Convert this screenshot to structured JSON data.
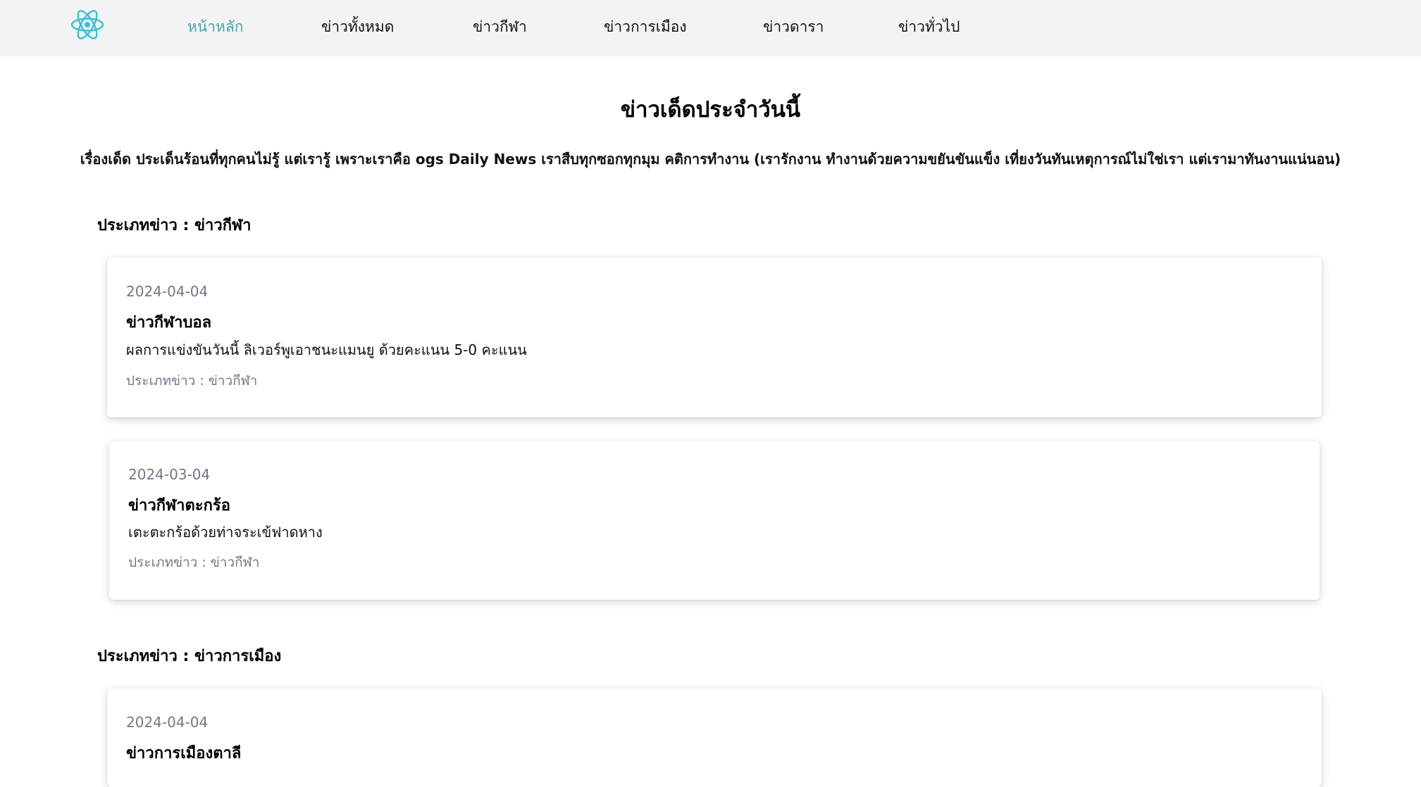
{
  "nav": {
    "items": [
      {
        "label": "หน้าหลัก",
        "active": true
      },
      {
        "label": "ข่าวทั้งหมด",
        "active": false
      },
      {
        "label": "ข่าวกีฬา",
        "active": false
      },
      {
        "label": "ข่าวการเมือง",
        "active": false
      },
      {
        "label": "ข่าวดารา",
        "active": false
      },
      {
        "label": "ข่าวทั่วไป",
        "active": false
      }
    ],
    "logo_icon": "react-atom-icon",
    "accent_color": "#3ea6b5"
  },
  "header": {
    "title": "ข่าวเด็ดประจำวันนี้",
    "intro": "เรื่องเด็ด ประเด็นร้อนที่ทุกคนไม่รู้ แต่เรารู้ เพราะเราคือ ogs Daily News เราสืบทุกซอกทุกมุม คติการทำงาน (เรารักงาน ทำงานด้วยความขยันขันแข็ง เที่ยงวันทันเหตุการณ์ไม่ใช่เรา แต่เรามาทันงานแน่นอน)"
  },
  "sections": [
    {
      "title": "ประเภทข่าว : ข่าวกีฬา",
      "cards": [
        {
          "date": "2024-04-04",
          "title": "ข่าวกีฬาบอล",
          "desc": "ผลการแข่งขันวันนี้ ลิเวอร์พูเอาชนะแมนยู ด้วยคะแนน 5-0 คะแนน",
          "category": "ประเภทข่าว : ข่าวกีฬา"
        },
        {
          "date": "2024-03-04",
          "title": "ข่าวกีฬาตะกร้อ",
          "desc": "เตะตะกร้อด้วยท่าจระเข้ฟาดหาง",
          "category": "ประเภทข่าว : ข่าวกีฬา"
        }
      ]
    },
    {
      "title": "ประเภทข่าว : ข่าวการเมือง",
      "cards": [
        {
          "date": "2024-04-04",
          "title": "ข่าวการเมืองตาลี"
        }
      ]
    }
  ]
}
